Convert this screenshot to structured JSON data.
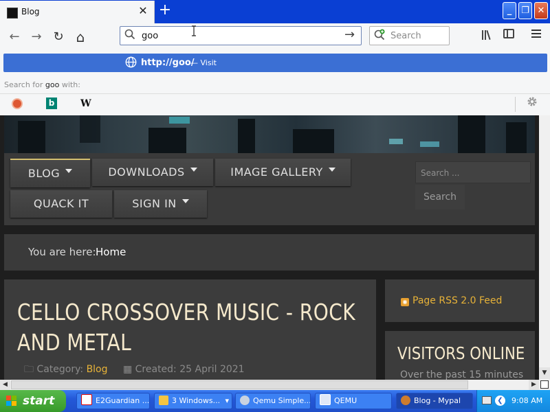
{
  "browser": {
    "tab": {
      "title": "Blog",
      "close": "✕"
    },
    "new_tab": "+",
    "window_controls": {
      "minimize": "_",
      "maximize": "❐",
      "close": "✕"
    },
    "nav": {
      "back_icon": "←",
      "forward_icon": "→",
      "reload_icon": "↻",
      "home_icon": "⌂"
    },
    "urlbar": {
      "value": "goo",
      "go_icon": "→"
    },
    "searchbar": {
      "placeholder": "Search"
    },
    "suggestion": {
      "url": "http://goo/",
      "dash": "—",
      "action": "Visit"
    },
    "search_for": {
      "prefix": "Search for",
      "term": "goo",
      "suffix": "with:"
    },
    "engines": [
      {
        "name": "DuckDuckGo",
        "icon": "duckduckgo-icon"
      },
      {
        "name": "Bing",
        "icon": "bing-icon",
        "glyph": "b"
      },
      {
        "name": "Wikipedia",
        "icon": "wikipedia-icon",
        "glyph": "W"
      }
    ]
  },
  "page": {
    "menu": [
      {
        "label": "BLOG",
        "has_caret": true,
        "active": true
      },
      {
        "label": "DOWNLOADS",
        "has_caret": true
      },
      {
        "label": "IMAGE GALLERY",
        "has_caret": true
      },
      {
        "label": "QUACK IT",
        "has_caret": false
      },
      {
        "label": "SIGN IN",
        "has_caret": true
      }
    ],
    "search": {
      "placeholder": "Search ...",
      "button": "Search"
    },
    "breadcrumb": {
      "label": "You are here:",
      "current": "Home"
    },
    "article": {
      "title": "CELLO CROSSOVER MUSIC - ROCK AND METAL",
      "category_label": "Category:",
      "category": "Blog",
      "created": "Created: 25 April 2021"
    },
    "rss": {
      "label": "Page RSS 2.0 Feed"
    },
    "visitors": {
      "title": "VISITORS ONLINE",
      "subtitle": "Over the past 15 minutes"
    }
  },
  "taskbar": {
    "start": "start",
    "tasks": [
      {
        "label": "E2Guardian ...",
        "icon": "yandex-icon",
        "color": "#e8e8e8"
      },
      {
        "label": "3 Windows...",
        "icon": "folder-icon",
        "color": "#f4c542",
        "group": "▾"
      },
      {
        "label": "Qemu Simple...",
        "icon": "qemu-icon",
        "color": "#c9d3e0"
      },
      {
        "label": "QEMU",
        "icon": "window-icon",
        "color": "#dfe8f7"
      },
      {
        "label": "Blog - Mypal",
        "icon": "mypal-icon",
        "color": "#ce7c2d",
        "active": true
      }
    ],
    "clock": "9:08 AM"
  }
}
